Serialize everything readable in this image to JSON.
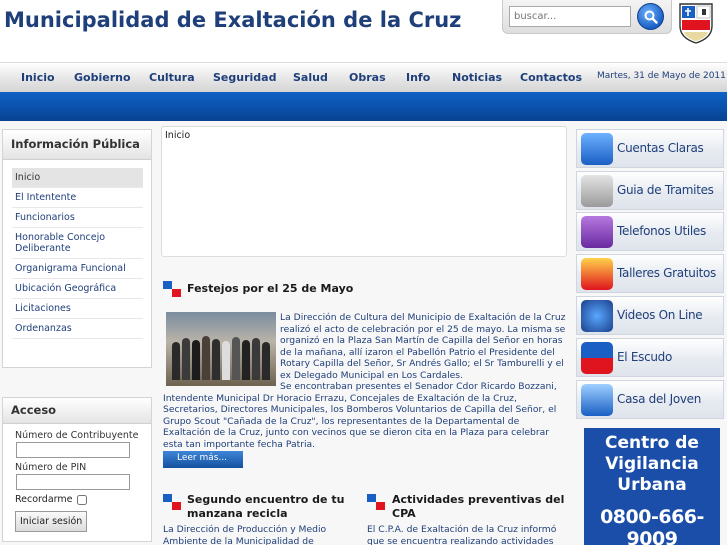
{
  "header": {
    "title": "Municipalidad de Exaltación de la Cruz",
    "search_placeholder": "buscar..."
  },
  "nav": {
    "items": [
      "Inicio",
      "Gobierno",
      "Cultura",
      "Seguridad",
      "Salud",
      "Obras",
      "Info",
      "Noticias",
      "Contactos"
    ],
    "date": "Martes, 31 de Mayo de 2011"
  },
  "sidebar": {
    "info_title": "Información Pública",
    "items": [
      "Inicio",
      "El Intentente",
      "Funcionarios",
      "Honorable Concejo Deliberante",
      "Organigrama Funcional",
      "Ubicación Geográfica",
      "Licitaciones",
      "Ordenanzas"
    ],
    "login": {
      "title": "Acceso",
      "contributor_label": "Número de Contribuyente",
      "pin_label": "Número de PIN",
      "remember_label": "Recordarme",
      "submit_label": "Iniciar sesión"
    }
  },
  "main": {
    "breadcrumb": "Inicio",
    "feature": {
      "title": "Festejos por el 25 de Mayo",
      "body": "La Dirección de Cultura del Municipio de Exaltación de la Cruz realizó el acto de celebración por el 25 de mayo. La misma se organizó en la Plaza San Martín de Capilla del Señor en horas de la mañana, allí izaron el Pabellón Patrio el Presidente del Rotary Capilla del Señor, Sr Andrés Gallo; el Sr Tamburelli y el ex Delegado Municipal en Los Cardales.",
      "body2": "Se encontraban presentes el Senador Cdor Ricardo Bozzani, Intendente Municipal Dr Horacio Errazu, Concejales de Exaltación de la Cruz, Secretarios, Directores Municipales, los Bomberos Voluntarios de Capilla del Señor, el Grupo Scout \"Cañada de la Cruz\", los representantes de la Departamental de Exaltación de la Cruz, junto con vecinos que se dieron cita en la Plaza para celebrar esta tan importante fecha Patria.",
      "read_more": "Leer más..."
    },
    "news": [
      {
        "title": "Segundo encuentro de tu manzana recicla",
        "body": "La Dirección de Producción y Medio Ambiente de la Municipalidad de"
      },
      {
        "title": "Actividades preventivas del CPA",
        "body": "El C.P.A. de Exaltación de la Cruz informó que se encuentra realizando actividades"
      }
    ]
  },
  "right": {
    "links": [
      "Cuentas Claras",
      "Guia de Tramites",
      "Telefonos Utiles",
      "Talleres Gratuitos",
      "Videos On Line",
      "El Escudo",
      "Casa del Joven"
    ],
    "vigilancia": {
      "line1": "Centro de",
      "line2": "Vigilancia",
      "line3": "Urbana",
      "phone": "0800-666-9009"
    }
  },
  "colors": {
    "brand_blue": "#1f3f7a",
    "band_blue": "#0a4fa8",
    "flag_blue": "#1a5fc4",
    "flag_red": "#e0141e"
  }
}
